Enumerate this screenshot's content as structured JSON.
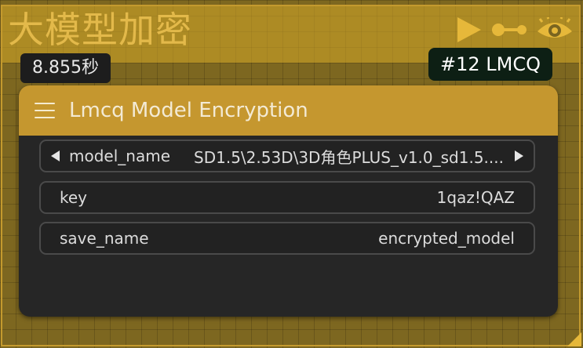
{
  "group": {
    "title": "大模型加密",
    "color": "#c49a2e",
    "icons": [
      "play-icon",
      "link-icon",
      "eye-icon"
    ]
  },
  "execution_time": "8.855秒",
  "node_badge": "#12 LMCQ",
  "node": {
    "title": "Lmcq Model Encryption",
    "header_color": "#c5972f",
    "widgets": {
      "model_name": {
        "label": "model_name",
        "value": "SD1.5\\2.53D\\3D角色PLUS_v1.0_sd1.5...."
      },
      "key": {
        "label": "key",
        "value": "1qaz!QAZ"
      },
      "save_name": {
        "label": "save_name",
        "value": "encrypted_model"
      }
    }
  }
}
